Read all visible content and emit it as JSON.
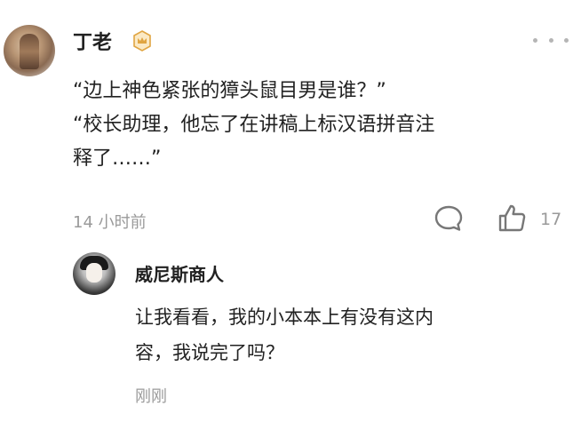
{
  "comment": {
    "username": "丁老",
    "badge_icon": "crown-badge-icon",
    "more_icon": "more-options-icon",
    "lines": [
      "“边上神色紧张的獐头鼠目男是谁？”",
      "“校长助理，他忘了在讲稿上标汉语拼音注",
      "释了……”"
    ],
    "time": "14 小时前",
    "reply_icon": "comment-bubble-icon",
    "like_icon": "thumbs-up-icon",
    "like_count": "17"
  },
  "reply": {
    "username": "威尼斯商人",
    "lines": [
      "让我看看，我的小本本上有没有这内",
      "容，我说完了吗？"
    ],
    "time": "刚刚"
  },
  "colors": {
    "text": "#222222",
    "muted": "#9a9a9a",
    "badge": "#e0a542"
  }
}
